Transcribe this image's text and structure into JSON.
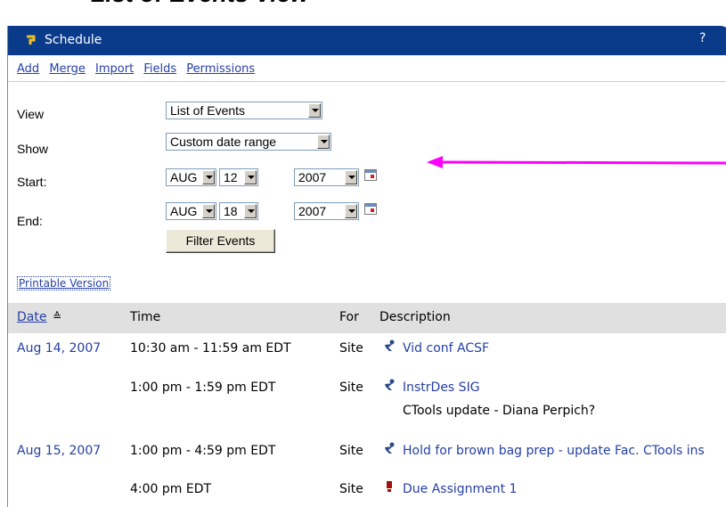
{
  "slide_title": "List of Events View",
  "tool": {
    "title": "Schedule",
    "help": "?"
  },
  "menu": [
    "Add",
    "Merge",
    "Import",
    "Fields",
    "Permissions"
  ],
  "filters": {
    "view_label": "View",
    "view_value": "List of Events",
    "show_label": "Show",
    "show_value": "Custom date range",
    "start_label": "Start:",
    "start": {
      "month": "AUG",
      "day": "12",
      "year": "2007"
    },
    "end_label": "End:",
    "end": {
      "month": "AUG",
      "day": "18",
      "year": "2007"
    },
    "button": "Filter Events"
  },
  "printable": "Printable Version",
  "table": {
    "headers": {
      "date": "Date",
      "sort": "≙",
      "time": "Time",
      "for": "For",
      "description": "Description"
    },
    "rows": [
      {
        "date": "Aug 14, 2007",
        "time": "10:30 am - 11:59 am EDT",
        "for": "Site",
        "icon": "meeting-icon",
        "title": "Vid conf ACSF",
        "note": ""
      },
      {
        "date": "",
        "time": "1:00 pm - 1:59 pm EDT",
        "for": "Site",
        "icon": "meeting-icon",
        "title": "InstrDes SIG",
        "note": "CTools update - Diana Perpich?"
      },
      {
        "date": "Aug 15, 2007",
        "time": "1:00 pm - 4:59 pm EDT",
        "for": "Site",
        "icon": "meeting-icon",
        "title": "Hold for brown bag prep - update Fac. CTools ins",
        "note": ""
      },
      {
        "date": "",
        "time": "4:00 pm EDT",
        "for": "Site",
        "icon": "deadline-icon",
        "title": "Due Assignment 1",
        "note": ""
      }
    ]
  },
  "colors": {
    "header_bar": "#0a3a8a",
    "link": "#2540a6",
    "arrow": "#ff00ff"
  }
}
